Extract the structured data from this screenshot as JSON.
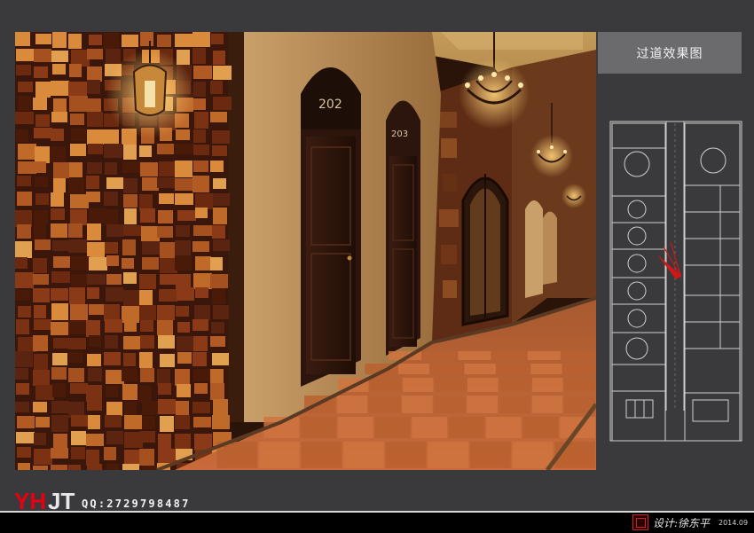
{
  "panel": {
    "title": "过道效果图"
  },
  "render": {
    "door_left_number": "202",
    "door_right_number": "203"
  },
  "footer": {
    "logo_text": "YHJT",
    "qq": "QQ:2729798487",
    "designer": "设计:徐东平",
    "date": "2014.09"
  },
  "colors": {
    "background": "#3a3a3c",
    "title_box": "#6b6b6d",
    "logo_red": "#e60012",
    "seal_red": "#c8262a"
  }
}
